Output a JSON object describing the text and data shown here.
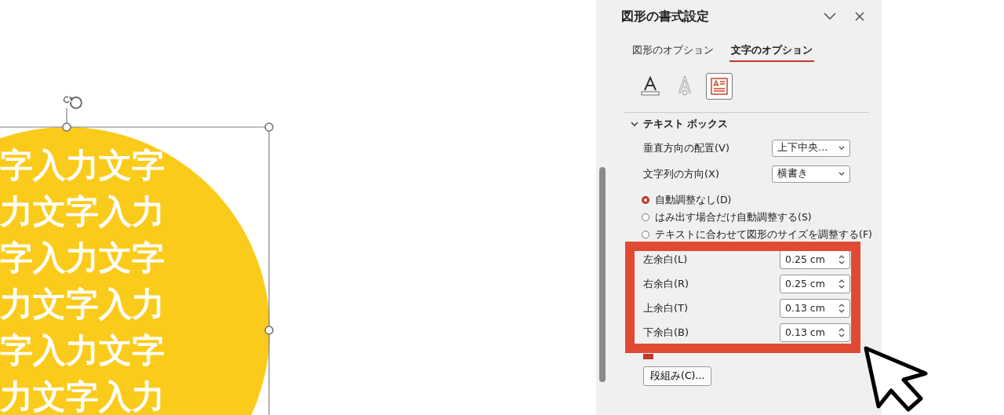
{
  "canvas": {
    "text_lines": [
      "字入力文字",
      "力文字入力",
      "字入力文字",
      "力文字入力",
      "字入力文字",
      "力文字入力"
    ]
  },
  "panel": {
    "title": "図形の書式設定",
    "tabs": [
      {
        "label": "図形のオプション",
        "selected": false
      },
      {
        "label": "文字のオプション",
        "selected": true
      }
    ],
    "icon_tabs": [
      {
        "kind": "text-fill",
        "selected": false
      },
      {
        "kind": "text-outline",
        "selected": false
      },
      {
        "kind": "text-box",
        "selected": true
      }
    ],
    "section": {
      "title": "テキスト ボックス",
      "expanded": true
    },
    "dropdowns": [
      {
        "label": "垂直方向の配置(V)",
        "value": "上下中央…"
      },
      {
        "label": "文字列の方向(X)",
        "value": "横書き"
      }
    ],
    "autofit": [
      {
        "label": "自動調整なし(D)",
        "selected": true
      },
      {
        "label": "はみ出す場合だけ自動調整する(S)",
        "selected": false
      },
      {
        "label": "テキストに合わせて図形のサイズを調整する(F)",
        "selected": false
      }
    ],
    "margins": [
      {
        "label": "左余白(L)",
        "value": "0.25 cm"
      },
      {
        "label": "右余白(R)",
        "value": "0.25 cm"
      },
      {
        "label": "上余白(T)",
        "value": "0.13 cm"
      },
      {
        "label": "下余白(B)",
        "value": "0.13 cm"
      }
    ],
    "wrap_checkbox": {
      "checked": true
    },
    "columns_button": "段組み(C)..."
  }
}
